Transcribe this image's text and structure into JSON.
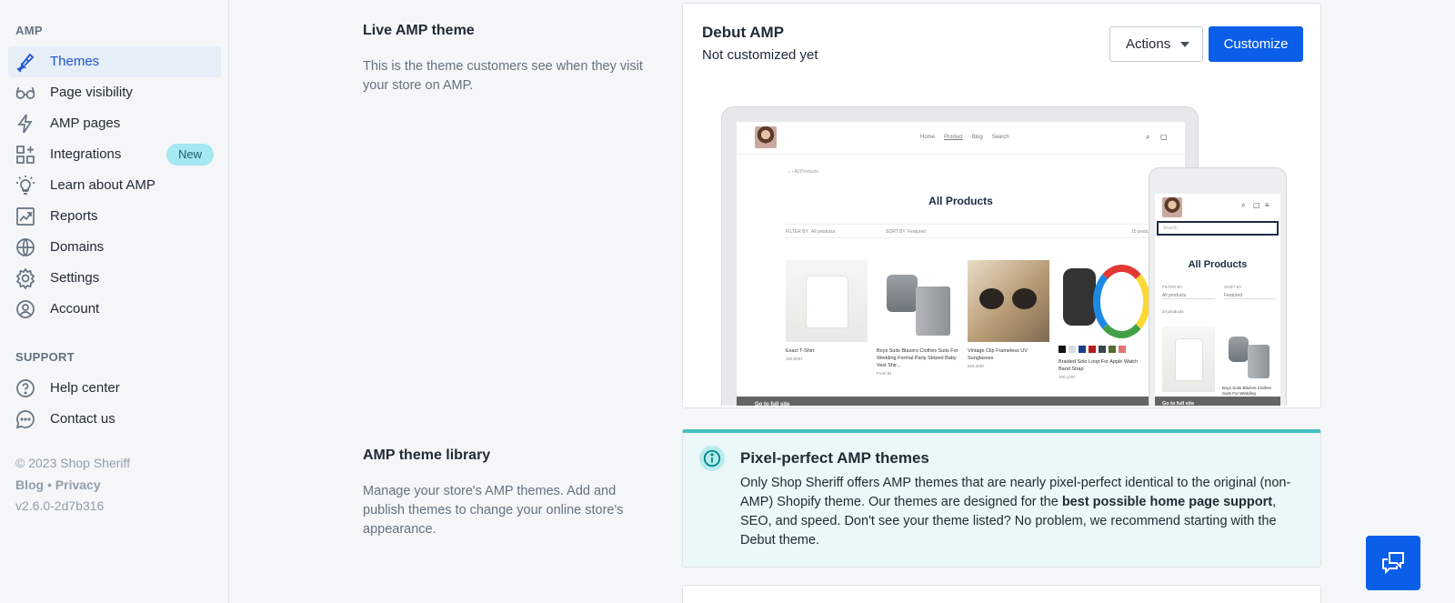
{
  "sidebar": {
    "section_amp": "AMP",
    "items": [
      {
        "label": "Themes",
        "icon": "paintbrush-icon"
      },
      {
        "label": "Page visibility",
        "icon": "glasses-icon"
      },
      {
        "label": "AMP pages",
        "icon": "lightning-icon"
      },
      {
        "label": "Integrations",
        "icon": "apps-icon",
        "badge": "New"
      },
      {
        "label": "Learn about AMP",
        "icon": "lightbulb-icon"
      },
      {
        "label": "Reports",
        "icon": "chart-icon"
      },
      {
        "label": "Domains",
        "icon": "globe-icon"
      },
      {
        "label": "Settings",
        "icon": "gear-icon"
      },
      {
        "label": "Account",
        "icon": "user-circle-icon"
      }
    ],
    "section_support": "SUPPORT",
    "support_items": [
      {
        "label": "Help center",
        "icon": "question-circle-icon"
      },
      {
        "label": "Contact us",
        "icon": "chat-bubble-icon"
      }
    ],
    "copyright": "© 2023 Shop Sheriff",
    "blog": "Blog",
    "separator": "•",
    "privacy": "Privacy",
    "version": "v2.6.0-2d7b316"
  },
  "live_section": {
    "title": "Live AMP theme",
    "description": "This is the theme customers see when they visit your store on AMP."
  },
  "theme_card": {
    "title": "Debut AMP",
    "subtitle": "Not customized yet",
    "actions_label": "Actions",
    "customize_label": "Customize"
  },
  "preview": {
    "nav": [
      "Home",
      "Product",
      "Blog",
      "Search"
    ],
    "crumb": "⌂ › All Products",
    "heading": "All Products",
    "filter_by": "FILTER BY",
    "filter_value": "All products",
    "sort_by": "SORT BY",
    "sort_value": "Featured",
    "count": "15 products",
    "products": [
      {
        "name": "Exact T-Shirt",
        "price": "150,000₫"
      },
      {
        "name": "Boys Suits Blazers Clothes Suits For Wedding Formal Party Striped Baby Vest Shir...",
        "price": "From $1"
      },
      {
        "name": "Vintage Clip Frameless UV Sunglasses",
        "price": "563,400₫"
      },
      {
        "name": "Braided Solo Loop For Apple Watch Band Strap",
        "price": "150,120₫"
      }
    ],
    "swatch_colors": [
      "#111111",
      "#d7dce0",
      "#1c3f8a",
      "#b71c1c",
      "#37474f",
      "#556b2f",
      "#e57373"
    ],
    "go_full": "Go to full site",
    "phone_search": "Search",
    "phone_heading": "All Products",
    "phone_filter": "FILTER BY",
    "phone_sort": "SORT BY",
    "phone_filter_value": "All products",
    "phone_sort_value": "Featured",
    "phone_count": "24 products",
    "phone_product": "Boys Suits Blazers Clothes Suits For Wedding",
    "phone_go_full": "Go to full site"
  },
  "library_section": {
    "title": "AMP theme library",
    "description": "Manage your store's AMP themes. Add and publish themes to change your online store's appearance."
  },
  "info_card": {
    "title": "Pixel-perfect AMP themes",
    "body_1": "Only Shop Sheriff offers AMP themes that are nearly pixel-perfect identical to the original (non-AMP) Shopify theme. Our themes are designed for the ",
    "body_bold": "best possible home page support",
    "body_2": ", SEO, and speed. Don't see your theme listed? No problem, we recommend starting with the Debut theme."
  },
  "colors": {
    "accent": "#0a5ee8",
    "active_nav_bg": "#e6eef8",
    "info_border": "#47c1bf",
    "badge_bg": "#a4e8f2"
  }
}
